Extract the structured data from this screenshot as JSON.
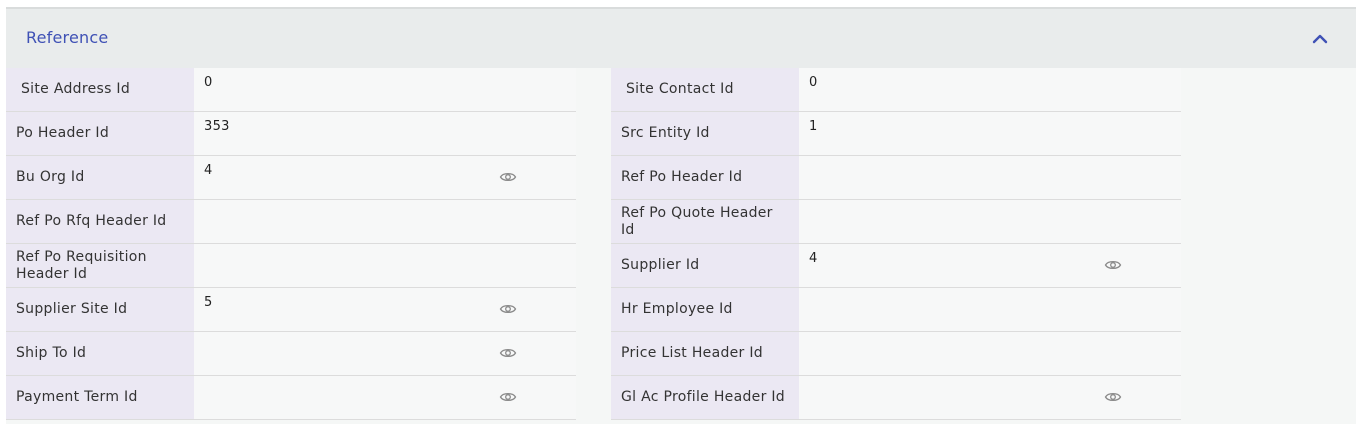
{
  "section": {
    "title": "Reference",
    "collapse_icon": "chevron-up-icon",
    "accent_color": "#3f51b5"
  },
  "left_fields": [
    {
      "label": "Site Address Id",
      "value": "0",
      "lookup": false
    },
    {
      "label": "Po Header Id",
      "value": "353",
      "lookup": false
    },
    {
      "label": "Bu Org Id",
      "value": "4",
      "lookup": true
    },
    {
      "label": "Ref Po Rfq Header Id",
      "value": "",
      "lookup": false
    },
    {
      "label": "Ref Po Requisition Header Id",
      "value": "",
      "lookup": false
    },
    {
      "label": "Supplier Site Id",
      "value": "5",
      "lookup": true
    },
    {
      "label": "Ship To Id",
      "value": "",
      "lookup": true
    },
    {
      "label": "Payment Term Id",
      "value": "",
      "lookup": true
    }
  ],
  "right_fields": [
    {
      "label": "Site Contact Id",
      "value": "0",
      "lookup": false
    },
    {
      "label": "Src Entity Id",
      "value": "1",
      "lookup": false
    },
    {
      "label": "Ref Po Header Id",
      "value": "",
      "lookup": false
    },
    {
      "label": "Ref Po Quote Header Id",
      "value": "",
      "lookup": false
    },
    {
      "label": "Supplier Id",
      "value": "4",
      "lookup": true
    },
    {
      "label": "Hr Employee Id",
      "value": "",
      "lookup": false
    },
    {
      "label": "Price List Header Id",
      "value": "",
      "lookup": false
    },
    {
      "label": "Gl Ac Profile Header Id",
      "value": "",
      "lookup": true
    }
  ]
}
